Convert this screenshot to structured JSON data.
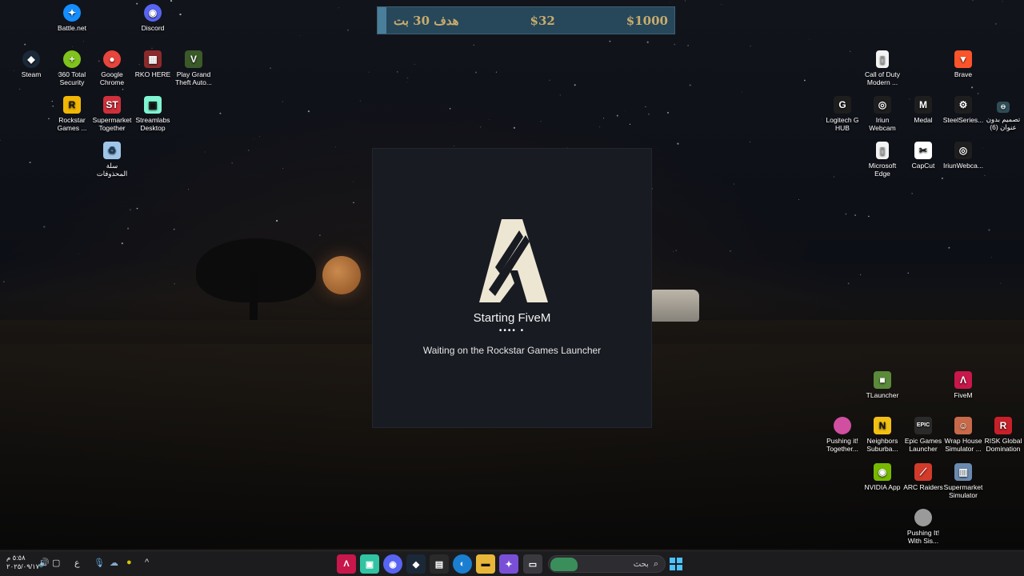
{
  "goal_bar": {
    "goal_text": "هدف 30 بت",
    "current_amount": "$32",
    "goal_amount": "$1000",
    "progress_fraction": 0.03
  },
  "desktop_icons_left": [
    {
      "label": "Battle.net",
      "icon": "battlenet-icon",
      "color": "#148eff"
    },
    {
      "label": "Discord",
      "icon": "discord-icon",
      "color": "#5865f2"
    },
    {
      "label": "Steam",
      "icon": "steam-icon",
      "color": "#1b2838"
    },
    {
      "label": "360 Total Security",
      "icon": "shield-plus-icon",
      "color": "#7fc31c"
    },
    {
      "label": "Google Chrome",
      "icon": "chrome-icon",
      "color": "#e8453c"
    },
    {
      "label": "RKO HERE",
      "icon": "archive-icon",
      "color": "#8b2a2a"
    },
    {
      "label": "Play Grand Theft Auto...",
      "icon": "gta-icon",
      "color": "#3a5a2a"
    },
    {
      "label": "Rockstar Games ...",
      "icon": "rockstar-icon",
      "color": "#f2b705"
    },
    {
      "label": "Supermarket Together",
      "icon": "supermarket-together-icon",
      "color": "#d0303b"
    },
    {
      "label": "Streamlabs Desktop",
      "icon": "streamlabs-icon",
      "color": "#80f5d2"
    },
    {
      "label": "سلة المحذوفات",
      "icon": "recycle-bin-icon",
      "color": "#9fc6e8"
    }
  ],
  "desktop_icons_right": [
    {
      "label": "Call of Duty Modern ...",
      "icon": "file-icon",
      "color": "#f3f3f3"
    },
    {
      "label": "Brave",
      "icon": "brave-icon",
      "color": "#fb542b"
    },
    {
      "label": "Logitech G HUB",
      "icon": "logitech-icon",
      "color": "#1e1e1e"
    },
    {
      "label": "Iriun Webcam",
      "icon": "webcam-icon",
      "color": "#1e1e1e"
    },
    {
      "label": "Medal",
      "icon": "medal-icon",
      "color": "#1e1e1e"
    },
    {
      "label": "SteelSeries...",
      "icon": "steelseries-icon",
      "color": "#1e1e1e"
    },
    {
      "label": "تصميم بدون عنوان (6)",
      "icon": "design-icon",
      "color": "#2f4d57"
    },
    {
      "label": "Microsoft Edge",
      "icon": "file-icon",
      "color": "#f3f3f3"
    },
    {
      "label": "CapCut",
      "icon": "capcut-icon",
      "color": "#111111"
    },
    {
      "label": "IriunWebca...",
      "icon": "webcam-icon",
      "color": "#1e1e1e"
    },
    {
      "label": "TLauncher",
      "icon": "tlauncher-icon",
      "color": "#5a8a3a"
    },
    {
      "label": "FiveM",
      "icon": "fivem-icon",
      "color": "#c8174a"
    },
    {
      "label": "Pushing it! Together...",
      "icon": "pushing-it-icon",
      "color": "#d04fa0"
    },
    {
      "label": "Neighbors Suburba...",
      "icon": "neighbors-icon",
      "color": "#f2c014"
    },
    {
      "label": "Epic Games Launcher",
      "icon": "epic-games-icon",
      "color": "#2a2a2a"
    },
    {
      "label": "Wrap House Simulator ...",
      "icon": "wrap-house-icon",
      "color": "#c86a4a"
    },
    {
      "label": "RISK Global Domination",
      "icon": "risk-icon",
      "color": "#c8202a"
    },
    {
      "label": "NVIDIA App",
      "icon": "nvidia-icon",
      "color": "#76b900"
    },
    {
      "label": "ARC Raiders",
      "icon": "arc-raiders-icon",
      "color": "#d23a2a"
    },
    {
      "label": "Supermarket Simulator",
      "icon": "supermarket-sim-icon",
      "color": "#6a8ab0"
    },
    {
      "label": "Pushing It! With Sis...",
      "icon": "pushing-it-sis-icon",
      "color": "#9a9a9a"
    }
  ],
  "launcher": {
    "title": "Starting FiveM",
    "dots": "•••• •",
    "status": "Waiting on the Rockstar Games Launcher",
    "logo_color": "#ede6d2"
  },
  "taskbar": {
    "search_placeholder": "بحث",
    "search_icon": "search-icon",
    "clock_time": "٥:٥٨ م",
    "clock_date": "٢٠٢٥/٠٩/١٧",
    "lang_indicator": "ع",
    "pinned": [
      {
        "name": "fivem-taskbar-icon",
        "glyph": "Λ",
        "color": "#c8174a"
      },
      {
        "name": "streamlabs-taskbar-icon",
        "glyph": "▣",
        "color": "#31c3a2"
      },
      {
        "name": "discord-taskbar-icon",
        "glyph": "◉",
        "color": "#5865f2"
      },
      {
        "name": "steam-taskbar-icon",
        "glyph": "◆",
        "color": "#1b2838"
      },
      {
        "name": "store-taskbar-icon",
        "glyph": "▤",
        "color": "#2a2a2a"
      },
      {
        "name": "edge-taskbar-icon",
        "glyph": "◐",
        "color": "#1a7fd1"
      },
      {
        "name": "file-explorer-taskbar-icon",
        "glyph": "▬",
        "color": "#e8b73a"
      },
      {
        "name": "copilot-taskbar-icon",
        "glyph": "✦",
        "color": "#7a4fd8"
      },
      {
        "name": "task-view-taskbar-icon",
        "glyph": "▭",
        "color": "#3a3a3e"
      }
    ],
    "tray": [
      {
        "name": "chevron-up-icon",
        "glyph": "^"
      },
      {
        "name": "360-tray-icon",
        "glyph": "●"
      },
      {
        "name": "cloud-tray-icon",
        "glyph": "☁"
      },
      {
        "name": "mic-tray-icon",
        "glyph": "🎙"
      },
      {
        "name": "display-tray-icon",
        "glyph": "▢"
      },
      {
        "name": "volume-icon",
        "glyph": "🔊"
      }
    ]
  }
}
